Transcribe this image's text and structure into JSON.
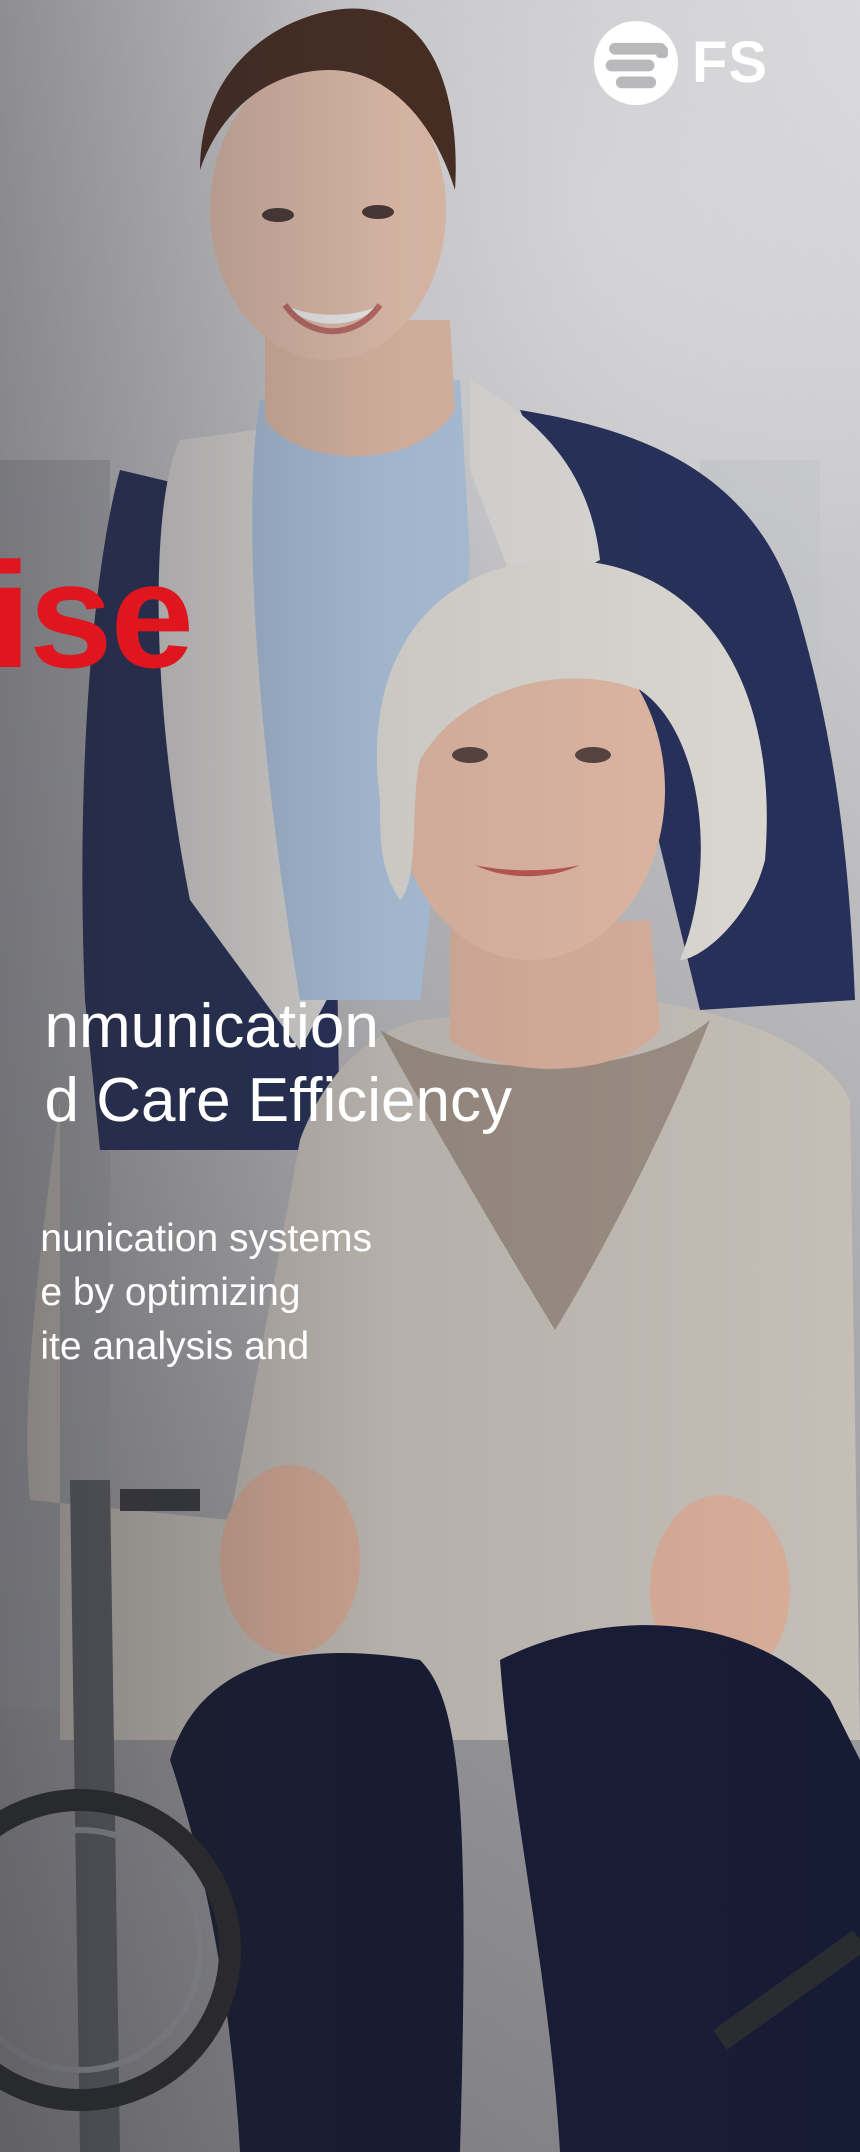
{
  "brand": {
    "logo_text": "FS",
    "logo_icon": "fs-logo-icon",
    "colors": {
      "accent": "#e0161f",
      "text_light": "#ffffff"
    }
  },
  "hero": {
    "headline": "ise",
    "subheadline": [
      "nmunication",
      "d Care Efficiency"
    ],
    "body": [
      "nunication systems",
      "e by optimizing",
      "ite analysis and"
    ]
  }
}
